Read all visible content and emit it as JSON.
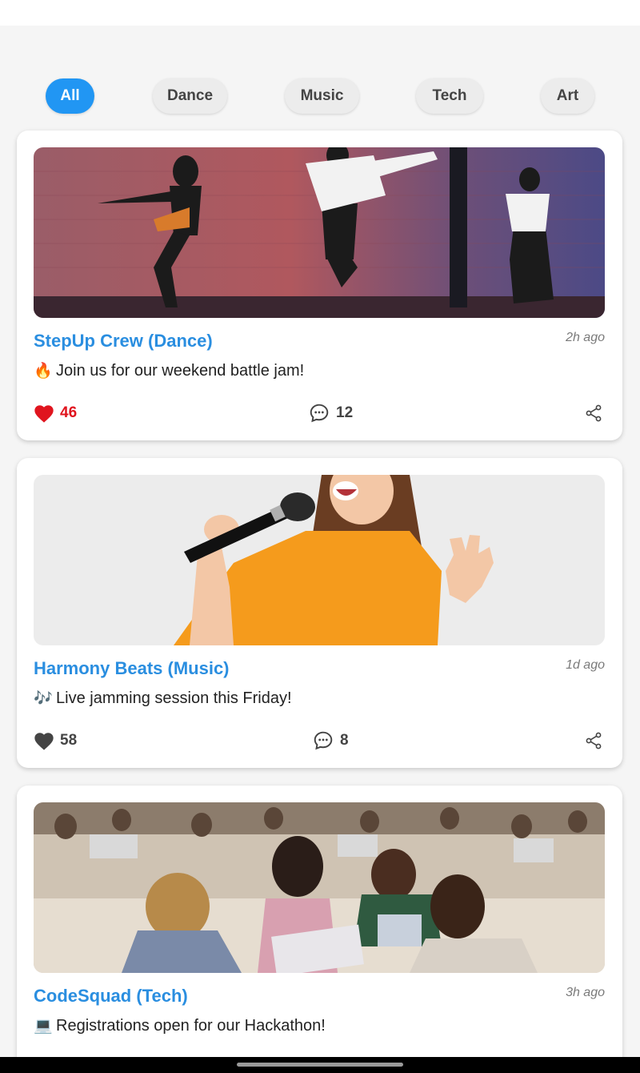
{
  "filters": [
    {
      "label": "All",
      "active": true
    },
    {
      "label": "Dance",
      "active": false
    },
    {
      "label": "Music",
      "active": false
    },
    {
      "label": "Tech",
      "active": false
    },
    {
      "label": "Art",
      "active": false
    }
  ],
  "posts": [
    {
      "club": "StepUp Crew (Dance)",
      "time": "2h ago",
      "emoji": "🔥",
      "text": "Join us for our weekend battle jam!",
      "likes": "46",
      "liked": true,
      "comments": "12",
      "image": "dance-crew-photo"
    },
    {
      "club": "Harmony Beats (Music)",
      "time": "1d ago",
      "emoji": "🎶",
      "text": "Live jamming session this Friday!",
      "likes": "58",
      "liked": false,
      "comments": "8",
      "image": "singer-with-microphone-photo"
    },
    {
      "club": "CodeSquad (Tech)",
      "time": "3h ago",
      "emoji": "💻",
      "text": "Registrations open for our Hackathon!",
      "image": "hackathon-room-photo"
    }
  ],
  "colors": {
    "accent": "#2196f3",
    "title": "#2a8ee0",
    "liked": "#e0141e",
    "unliked": "#444444"
  },
  "icons": {
    "like": "heart-icon",
    "comment": "comment-bubble-icon",
    "share": "share-icon"
  }
}
